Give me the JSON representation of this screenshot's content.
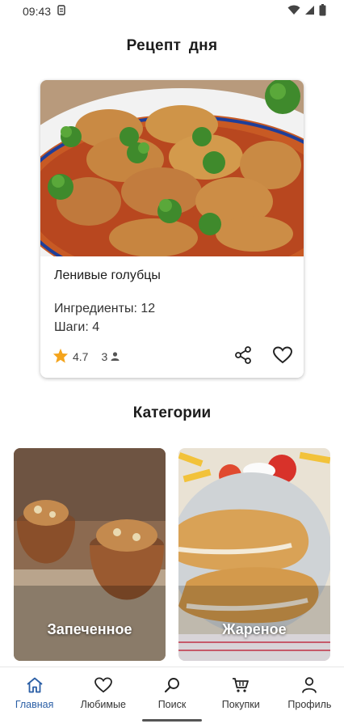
{
  "status_bar": {
    "time": "09:43"
  },
  "page": {
    "title": "Рецепт  дня"
  },
  "recipe_of_day": {
    "name": "Ленивые голубцы",
    "ingredients": "Ингредиенты: 12",
    "steps": "Шаги: 4",
    "rating": "4.7",
    "reviews_count": "3",
    "image_icon": "stuffed-cabbage-dish-photo"
  },
  "categories": {
    "title": "Категории",
    "items": [
      {
        "label": "Запеченное",
        "image_icon": "baked-pots-photo"
      },
      {
        "label": "Жареное",
        "image_icon": "fried-schnitzel-photo"
      }
    ]
  },
  "bottom_nav": {
    "items": [
      {
        "label": "Главная",
        "icon": "home-icon",
        "active": true
      },
      {
        "label": "Любимые",
        "icon": "heart-icon",
        "active": false
      },
      {
        "label": "Поиск",
        "icon": "search-icon",
        "active": false
      },
      {
        "label": "Покупки",
        "icon": "cart-icon",
        "active": false
      },
      {
        "label": "Профиль",
        "icon": "person-icon",
        "active": false
      }
    ]
  },
  "colors": {
    "accent": "#2b5fa6",
    "star": "#f4a41c",
    "text": "#1c1c1c"
  }
}
